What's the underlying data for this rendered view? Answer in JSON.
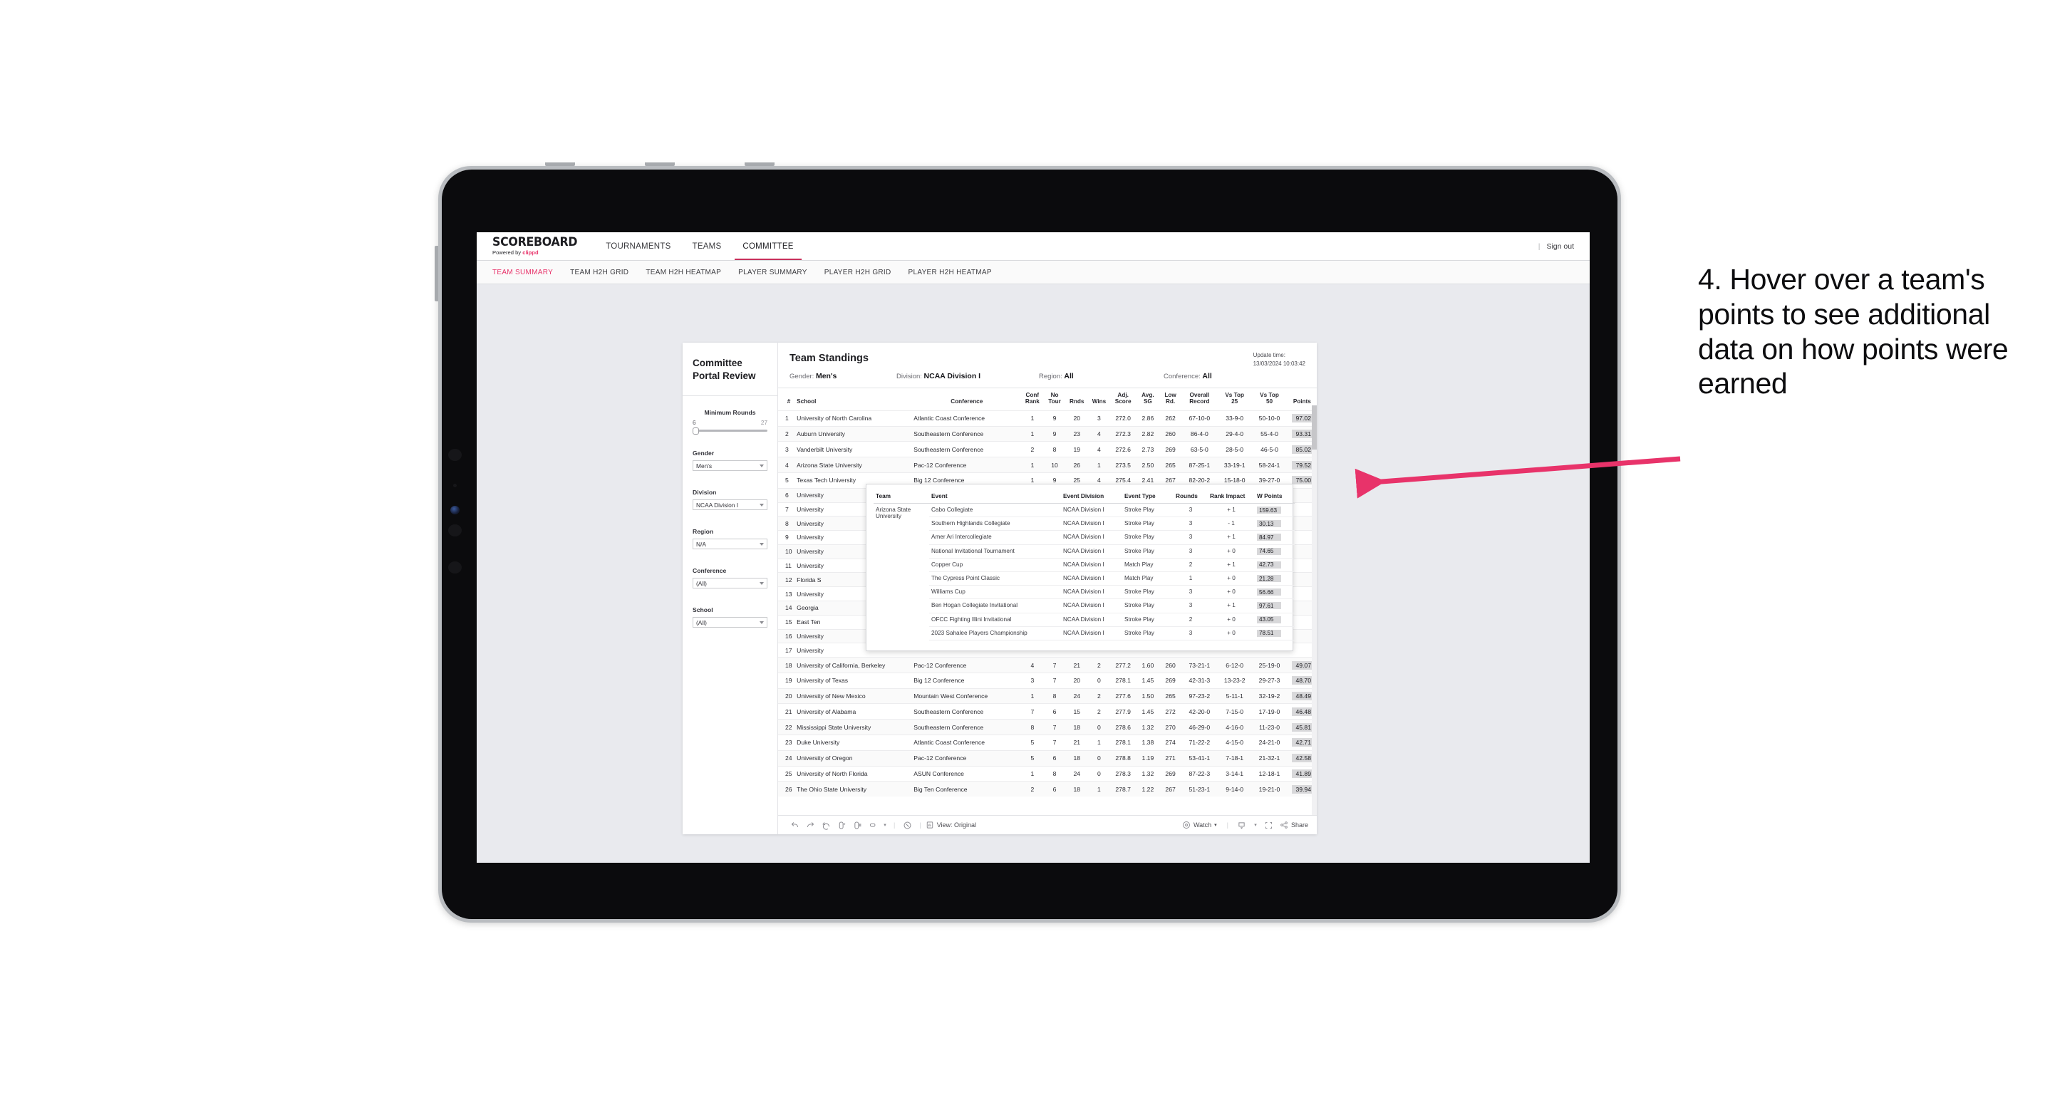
{
  "annotation": {
    "text": "4. Hover over a team's points to see additional data on how points were earned",
    "arrow_color": "#e8336a"
  },
  "topnav": {
    "brand_title": "SCOREBOARD",
    "brand_sub_prefix": "Powered by ",
    "brand_sub_accent": "clippd",
    "items": [
      {
        "label": "TOURNAMENTS",
        "active": false
      },
      {
        "label": "TEAMS",
        "active": false
      },
      {
        "label": "COMMITTEE",
        "active": true
      }
    ],
    "divider": "|",
    "signout": "Sign out"
  },
  "subnav": {
    "items": [
      {
        "label": "TEAM SUMMARY",
        "active": true
      },
      {
        "label": "TEAM H2H GRID",
        "active": false
      },
      {
        "label": "TEAM H2H HEATMAP",
        "active": false
      },
      {
        "label": "PLAYER SUMMARY",
        "active": false
      },
      {
        "label": "PLAYER H2H GRID",
        "active": false
      },
      {
        "label": "PLAYER H2H HEATMAP",
        "active": false
      }
    ]
  },
  "filters": {
    "portal_title_line1": "Committee",
    "portal_title_line2": "Portal Review",
    "min_rounds": {
      "label": "Minimum Rounds",
      "min": "6",
      "max": "27"
    },
    "gender": {
      "label": "Gender",
      "value": "Men's"
    },
    "division": {
      "label": "Division",
      "value": "NCAA Division I"
    },
    "region": {
      "label": "Region",
      "value": "N/A"
    },
    "conference": {
      "label": "Conference",
      "value": "(All)"
    },
    "school": {
      "label": "School",
      "value": "(All)"
    }
  },
  "standings": {
    "title": "Team Standings",
    "update_time_label": "Update time:",
    "update_time_value": "13/03/2024 10:03:42",
    "meta": [
      {
        "label": "Gender:",
        "value": "Men's"
      },
      {
        "label": "Division:",
        "value": "NCAA Division I"
      },
      {
        "label": "Region:",
        "value": "All"
      },
      {
        "label": "Conference:",
        "value": "All"
      }
    ],
    "columns": [
      "#",
      "School",
      "Conference",
      "Conf Rank",
      "No Tour",
      "Rnds",
      "Wins",
      "Adj. Score",
      "Avg. SG",
      "Low Rd.",
      "Overall Record",
      "Vs Top 25",
      "Vs Top 50",
      "Points"
    ],
    "columns_split": [
      {
        "l1": "#",
        "l2": ""
      },
      {
        "l1": "School",
        "l2": ""
      },
      {
        "l1": "Conference",
        "l2": ""
      },
      {
        "l1": "Conf",
        "l2": "Rank"
      },
      {
        "l1": "No",
        "l2": "Tour"
      },
      {
        "l1": "Rnds",
        "l2": ""
      },
      {
        "l1": "Wins",
        "l2": ""
      },
      {
        "l1": "Adj.",
        "l2": "Score"
      },
      {
        "l1": "Avg.",
        "l2": "SG"
      },
      {
        "l1": "Low",
        "l2": "Rd."
      },
      {
        "l1": "Overall",
        "l2": "Record"
      },
      {
        "l1": "Vs Top",
        "l2": "25"
      },
      {
        "l1": "Vs Top",
        "l2": "50"
      },
      {
        "l1": "Points",
        "l2": ""
      }
    ],
    "rows": [
      {
        "rank": "1",
        "school": "University of North Carolina",
        "conf": "Atlantic Coast Conference",
        "confrank": "1",
        "notour": "9",
        "rnds": "20",
        "wins": "3",
        "adj": "272.0",
        "sg": "2.86",
        "low": "262",
        "rec": "67-10-0",
        "t25": "33-9-0",
        "t50": "50-10-0",
        "pts": "97.02"
      },
      {
        "rank": "2",
        "school": "Auburn University",
        "conf": "Southeastern Conference",
        "confrank": "1",
        "notour": "9",
        "rnds": "23",
        "wins": "4",
        "adj": "272.3",
        "sg": "2.82",
        "low": "260",
        "rec": "86-4-0",
        "t25": "29-4-0",
        "t50": "55-4-0",
        "pts": "93.31"
      },
      {
        "rank": "3",
        "school": "Vanderbilt University",
        "conf": "Southeastern Conference",
        "confrank": "2",
        "notour": "8",
        "rnds": "19",
        "wins": "4",
        "adj": "272.6",
        "sg": "2.73",
        "low": "269",
        "rec": "63-5-0",
        "t25": "28-5-0",
        "t50": "46-5-0",
        "pts": "85.02"
      },
      {
        "rank": "4",
        "school": "Arizona State University",
        "conf": "Pac-12 Conference",
        "confrank": "1",
        "notour": "10",
        "rnds": "26",
        "wins": "1",
        "adj": "273.5",
        "sg": "2.50",
        "low": "265",
        "rec": "87-25-1",
        "t25": "33-19-1",
        "t50": "58-24-1",
        "pts": "79.52"
      },
      {
        "rank": "5",
        "school": "Texas Tech University",
        "conf": "Big 12 Conference",
        "confrank": "1",
        "notour": "9",
        "rnds": "25",
        "wins": "4",
        "adj": "275.4",
        "sg": "2.41",
        "low": "267",
        "rec": "82-20-2",
        "t25": "15-18-0",
        "t50": "39-27-0",
        "pts": "75.00"
      },
      {
        "rank": "6",
        "school": "University",
        "conf": "",
        "confrank": "",
        "notour": "",
        "rnds": "",
        "wins": "",
        "adj": "",
        "sg": "",
        "low": "",
        "rec": "",
        "t25": "",
        "t50": "",
        "pts": ""
      },
      {
        "rank": "7",
        "school": "University",
        "conf": "",
        "confrank": "",
        "notour": "",
        "rnds": "",
        "wins": "",
        "adj": "",
        "sg": "",
        "low": "",
        "rec": "",
        "t25": "",
        "t50": "",
        "pts": ""
      },
      {
        "rank": "8",
        "school": "University",
        "conf": "",
        "confrank": "",
        "notour": "",
        "rnds": "",
        "wins": "",
        "adj": "",
        "sg": "",
        "low": "",
        "rec": "",
        "t25": "",
        "t50": "",
        "pts": ""
      },
      {
        "rank": "9",
        "school": "University",
        "conf": "",
        "confrank": "",
        "notour": "",
        "rnds": "",
        "wins": "",
        "adj": "",
        "sg": "",
        "low": "",
        "rec": "",
        "t25": "",
        "t50": "",
        "pts": ""
      },
      {
        "rank": "10",
        "school": "University",
        "conf": "",
        "confrank": "",
        "notour": "",
        "rnds": "",
        "wins": "",
        "adj": "",
        "sg": "",
        "low": "",
        "rec": "",
        "t25": "",
        "t50": "",
        "pts": ""
      },
      {
        "rank": "11",
        "school": "University",
        "conf": "",
        "confrank": "",
        "notour": "",
        "rnds": "",
        "wins": "",
        "adj": "",
        "sg": "",
        "low": "",
        "rec": "",
        "t25": "",
        "t50": "",
        "pts": ""
      },
      {
        "rank": "12",
        "school": "Florida S",
        "conf": "",
        "confrank": "",
        "notour": "",
        "rnds": "",
        "wins": "",
        "adj": "",
        "sg": "",
        "low": "",
        "rec": "",
        "t25": "",
        "t50": "",
        "pts": ""
      },
      {
        "rank": "13",
        "school": "University",
        "conf": "",
        "confrank": "",
        "notour": "",
        "rnds": "",
        "wins": "",
        "adj": "",
        "sg": "",
        "low": "",
        "rec": "",
        "t25": "",
        "t50": "",
        "pts": ""
      },
      {
        "rank": "14",
        "school": "Georgia",
        "conf": "",
        "confrank": "",
        "notour": "",
        "rnds": "",
        "wins": "",
        "adj": "",
        "sg": "",
        "low": "",
        "rec": "",
        "t25": "",
        "t50": "",
        "pts": ""
      },
      {
        "rank": "15",
        "school": "East Ten",
        "conf": "",
        "confrank": "",
        "notour": "",
        "rnds": "",
        "wins": "",
        "adj": "",
        "sg": "",
        "low": "",
        "rec": "",
        "t25": "",
        "t50": "",
        "pts": ""
      },
      {
        "rank": "16",
        "school": "University",
        "conf": "",
        "confrank": "",
        "notour": "",
        "rnds": "",
        "wins": "",
        "adj": "",
        "sg": "",
        "low": "",
        "rec": "",
        "t25": "",
        "t50": "",
        "pts": ""
      },
      {
        "rank": "17",
        "school": "University",
        "conf": "",
        "confrank": "",
        "notour": "",
        "rnds": "",
        "wins": "",
        "adj": "",
        "sg": "",
        "low": "",
        "rec": "",
        "t25": "",
        "t50": "",
        "pts": ""
      },
      {
        "rank": "18",
        "school": "University of California, Berkeley",
        "conf": "Pac-12 Conference",
        "confrank": "4",
        "notour": "7",
        "rnds": "21",
        "wins": "2",
        "adj": "277.2",
        "sg": "1.60",
        "low": "260",
        "rec": "73-21-1",
        "t25": "6-12-0",
        "t50": "25-19-0",
        "pts": "49.07"
      },
      {
        "rank": "19",
        "school": "University of Texas",
        "conf": "Big 12 Conference",
        "confrank": "3",
        "notour": "7",
        "rnds": "20",
        "wins": "0",
        "adj": "278.1",
        "sg": "1.45",
        "low": "269",
        "rec": "42-31-3",
        "t25": "13-23-2",
        "t50": "29-27-3",
        "pts": "48.70"
      },
      {
        "rank": "20",
        "school": "University of New Mexico",
        "conf": "Mountain West Conference",
        "confrank": "1",
        "notour": "8",
        "rnds": "24",
        "wins": "2",
        "adj": "277.6",
        "sg": "1.50",
        "low": "265",
        "rec": "97-23-2",
        "t25": "5-11-1",
        "t50": "32-19-2",
        "pts": "48.49"
      },
      {
        "rank": "21",
        "school": "University of Alabama",
        "conf": "Southeastern Conference",
        "confrank": "7",
        "notour": "6",
        "rnds": "15",
        "wins": "2",
        "adj": "277.9",
        "sg": "1.45",
        "low": "272",
        "rec": "42-20-0",
        "t25": "7-15-0",
        "t50": "17-19-0",
        "pts": "46.48"
      },
      {
        "rank": "22",
        "school": "Mississippi State University",
        "conf": "Southeastern Conference",
        "confrank": "8",
        "notour": "7",
        "rnds": "18",
        "wins": "0",
        "adj": "278.6",
        "sg": "1.32",
        "low": "270",
        "rec": "46-29-0",
        "t25": "4-16-0",
        "t50": "11-23-0",
        "pts": "45.81"
      },
      {
        "rank": "23",
        "school": "Duke University",
        "conf": "Atlantic Coast Conference",
        "confrank": "5",
        "notour": "7",
        "rnds": "21",
        "wins": "1",
        "adj": "278.1",
        "sg": "1.38",
        "low": "274",
        "rec": "71-22-2",
        "t25": "4-15-0",
        "t50": "24-21-0",
        "pts": "42.71"
      },
      {
        "rank": "24",
        "school": "University of Oregon",
        "conf": "Pac-12 Conference",
        "confrank": "5",
        "notour": "6",
        "rnds": "18",
        "wins": "0",
        "adj": "278.8",
        "sg": "1.19",
        "low": "271",
        "rec": "53-41-1",
        "t25": "7-18-1",
        "t50": "21-32-1",
        "pts": "42.58"
      },
      {
        "rank": "25",
        "school": "University of North Florida",
        "conf": "ASUN Conference",
        "confrank": "1",
        "notour": "8",
        "rnds": "24",
        "wins": "0",
        "adj": "278.3",
        "sg": "1.32",
        "low": "269",
        "rec": "87-22-3",
        "t25": "3-14-1",
        "t50": "12-18-1",
        "pts": "41.89"
      },
      {
        "rank": "26",
        "school": "The Ohio State University",
        "conf": "Big Ten Conference",
        "confrank": "2",
        "notour": "6",
        "rnds": "18",
        "wins": "1",
        "adj": "278.7",
        "sg": "1.22",
        "low": "267",
        "rec": "51-23-1",
        "t25": "9-14-0",
        "t50": "19-21-0",
        "pts": "39.94"
      }
    ]
  },
  "tooltip": {
    "columns": [
      "Team",
      "Event",
      "Event Division",
      "Event Type",
      "Rounds",
      "Rank Impact",
      "W Points"
    ],
    "team": "Arizona State University",
    "rows": [
      {
        "event": "Cabo Collegiate",
        "div": "NCAA Division I",
        "type": "Stroke Play",
        "rounds": "3",
        "impact": "+ 1",
        "pts": "159.63"
      },
      {
        "event": "Southern Highlands Collegiate",
        "div": "NCAA Division I",
        "type": "Stroke Play",
        "rounds": "3",
        "impact": "- 1",
        "pts": "30.13"
      },
      {
        "event": "Amer Ari Intercollegiate",
        "div": "NCAA Division I",
        "type": "Stroke Play",
        "rounds": "3",
        "impact": "+ 1",
        "pts": "84.97"
      },
      {
        "event": "National Invitational Tournament",
        "div": "NCAA Division I",
        "type": "Stroke Play",
        "rounds": "3",
        "impact": "+ 0",
        "pts": "74.65"
      },
      {
        "event": "Copper Cup",
        "div": "NCAA Division I",
        "type": "Match Play",
        "rounds": "2",
        "impact": "+ 1",
        "pts": "42.73"
      },
      {
        "event": "The Cypress Point Classic",
        "div": "NCAA Division I",
        "type": "Match Play",
        "rounds": "1",
        "impact": "+ 0",
        "pts": "21.28"
      },
      {
        "event": "Williams Cup",
        "div": "NCAA Division I",
        "type": "Stroke Play",
        "rounds": "3",
        "impact": "+ 0",
        "pts": "56.66"
      },
      {
        "event": "Ben Hogan Collegiate Invitational",
        "div": "NCAA Division I",
        "type": "Stroke Play",
        "rounds": "3",
        "impact": "+ 1",
        "pts": "97.61"
      },
      {
        "event": "OFCC Fighting Illini Invitational",
        "div": "NCAA Division I",
        "type": "Stroke Play",
        "rounds": "2",
        "impact": "+ 0",
        "pts": "43.05"
      },
      {
        "event": "2023 Sahalee Players Championship",
        "div": "NCAA Division I",
        "type": "Stroke Play",
        "rounds": "3",
        "impact": "+ 0",
        "pts": "78.51"
      }
    ]
  },
  "toolbar": {
    "view_label": "View: Original",
    "watch_label": "Watch",
    "share_label": "Share",
    "caret": "▾"
  }
}
